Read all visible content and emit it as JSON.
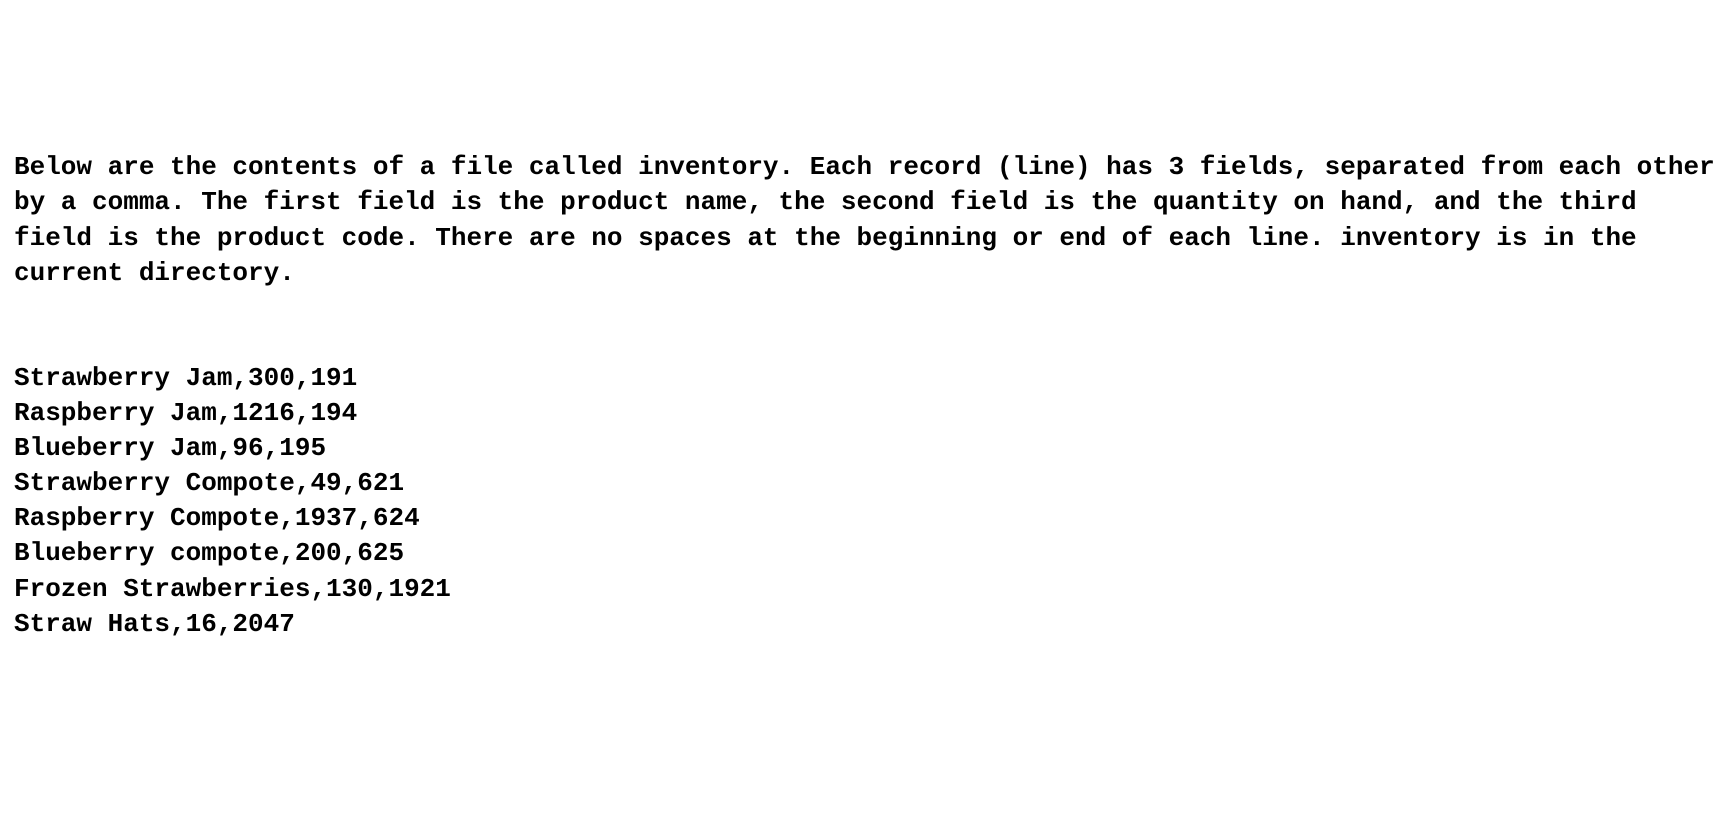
{
  "intro": "Below are the contents of a file called inventory. Each record (line) has 3 fields, separated from each other by a comma. The first field is the product name, the second field is the quantity on hand, and the third field is the product code. There are no spaces at the beginning or end of each line. inventory is in the current directory.",
  "records": [
    {
      "product_name": "Strawberry Jam",
      "quantity": 300,
      "product_code": 191
    },
    {
      "product_name": "Raspberry Jam",
      "quantity": 1216,
      "product_code": 194
    },
    {
      "product_name": "Blueberry Jam",
      "quantity": 96,
      "product_code": 195
    },
    {
      "product_name": "Strawberry Compote",
      "quantity": 49,
      "product_code": 621
    },
    {
      "product_name": "Raspberry Compote",
      "quantity": 1937,
      "product_code": 624
    },
    {
      "product_name": "Blueberry compote",
      "quantity": 200,
      "product_code": 625
    },
    {
      "product_name": "Frozen Strawberries",
      "quantity": 130,
      "product_code": 1921
    },
    {
      "product_name": "Straw Hats",
      "quantity": 16,
      "product_code": 2047
    }
  ]
}
